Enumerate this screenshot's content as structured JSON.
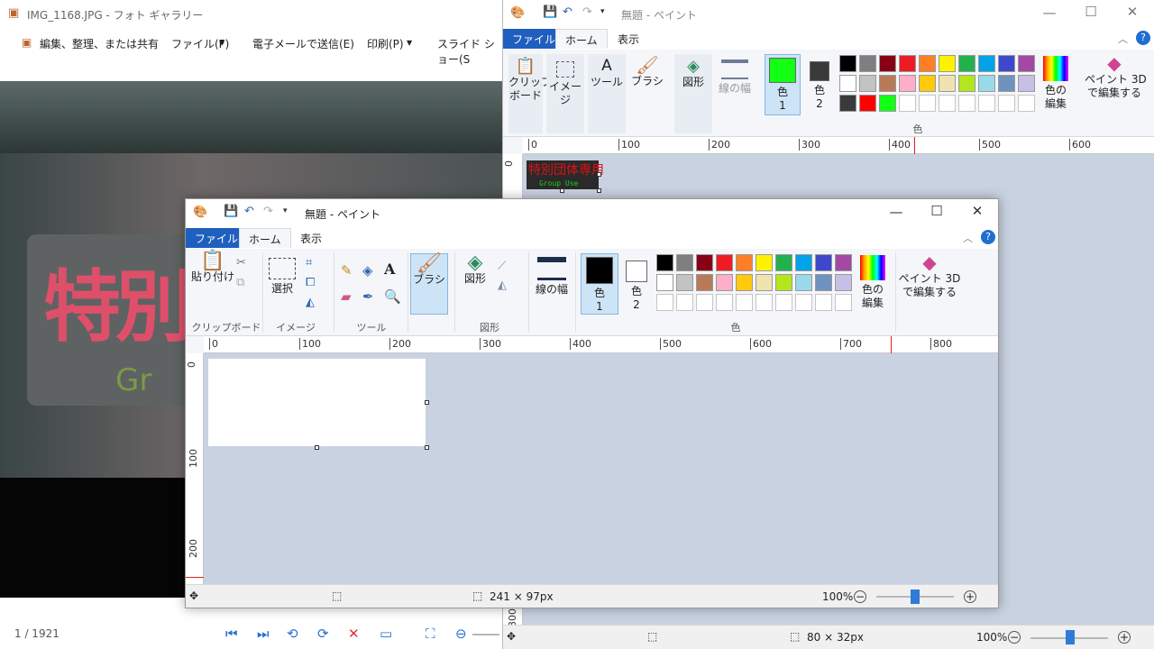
{
  "gallery": {
    "title": "IMG_1168.JPG - フォト ギャラリー",
    "menu": [
      "編集、整理、または共有",
      "ファイル(F)",
      "電子メールで送信(E)",
      "印刷(P)",
      "スライド ショー(S"
    ],
    "led_text": "特別",
    "led_sub": "Gr",
    "counter": "1 / 1921"
  },
  "paint_back": {
    "title": "無題 - ペイント",
    "tabs": [
      "ファイル",
      "ホーム",
      "表示"
    ],
    "buttons": {
      "clipboard": "クリップ\nボード",
      "image": "イメージ",
      "tools": "ツール",
      "brush": "ブラシ",
      "shapes": "図形",
      "width": "線の幅",
      "color1": "色\n1",
      "color2": "色\n2",
      "edit_colors": "色の\n編集",
      "paint3d": "ペイント 3D\nで編集する"
    },
    "color_group_label": "色",
    "ruler": [
      "0",
      "100",
      "200",
      "300",
      "400",
      "500",
      "600"
    ],
    "thumb_text": "特別団体専用",
    "thumb_sub": "Group Use",
    "status": {
      "size": "80 × 32px",
      "zoom": "100%"
    },
    "color1_hex": "#13ff13",
    "color2_hex": "#3a3a3a"
  },
  "paint_front": {
    "title": "無題 - ペイント",
    "tabs": [
      "ファイル",
      "ホーム",
      "表示"
    ],
    "buttons": {
      "paste": "貼り付け",
      "select": "選択",
      "brush": "ブラシ",
      "shapes": "図形",
      "width": "線の幅",
      "color1": "色\n1",
      "color2": "色\n2",
      "edit_colors": "色の\n編集",
      "paint3d": "ペイント 3D\nで編集する"
    },
    "groups": [
      "クリップボード",
      "イメージ",
      "ツール",
      "図形",
      "色"
    ],
    "ruler_h": [
      "0",
      "100",
      "200",
      "300",
      "400",
      "500",
      "600",
      "700",
      "800"
    ],
    "ruler_v": [
      "0",
      "100",
      "200"
    ],
    "status": {
      "size": "241 × 97px",
      "zoom": "100%"
    },
    "color1_hex": "#000000",
    "color2_hex": "#ffffff"
  },
  "palette": [
    "#000000",
    "#7f7f7f",
    "#880015",
    "#ed1c24",
    "#ff7f27",
    "#fff200",
    "#22b14c",
    "#00a2e8",
    "#3f48cc",
    "#a349a4",
    "#ffffff",
    "#c3c3c3",
    "#b97a57",
    "#ffaec9",
    "#ffc90e",
    "#efe4b0",
    "#b5e61d",
    "#99d9ea",
    "#7092be",
    "#c8bfe7",
    "#ffffff",
    "#ffffff",
    "#ffffff",
    "#ffffff",
    "#ffffff",
    "#ffffff",
    "#ffffff",
    "#ffffff",
    "#ffffff",
    "#ffffff"
  ],
  "palette_back_row3": [
    "#3a3a3a",
    "#ff0000",
    "#13ff13"
  ]
}
